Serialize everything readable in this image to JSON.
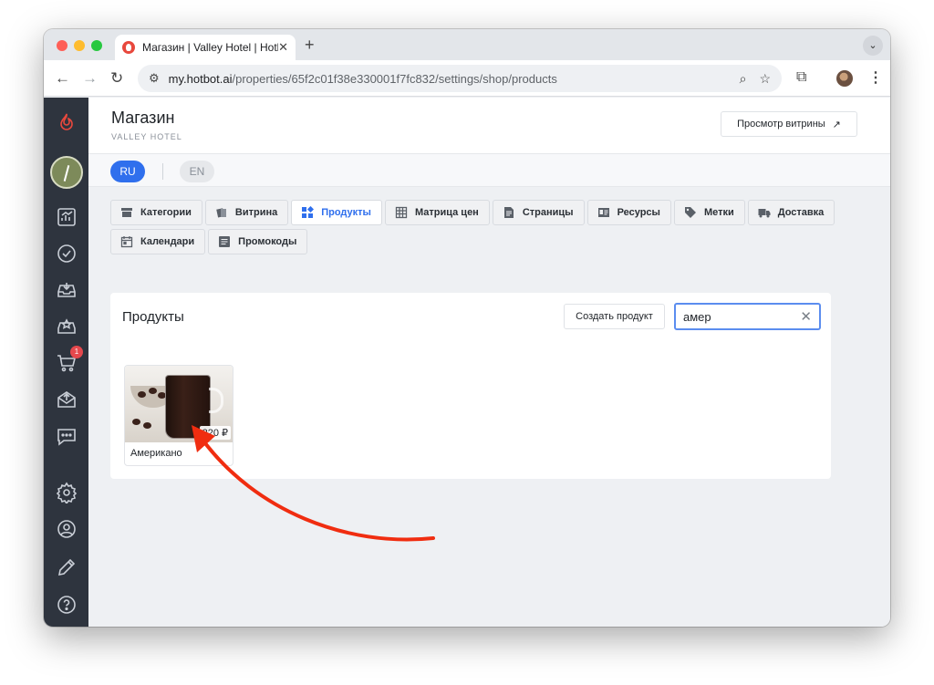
{
  "browser": {
    "tab_title": "Магазин | Valley Hotel | Hotbot",
    "tab_close": "✕",
    "new_tab": "+",
    "url_host": "my.hotbot.ai",
    "url_path": "/properties/65f2c01f38e330001f7fc832/settings/shop/products"
  },
  "header": {
    "title": "Магазин",
    "subtitle": "VALLEY HOTEL",
    "view_storefront_label": "Просмотр витрины",
    "view_storefront_icon": "↗"
  },
  "languages": {
    "active": "RU",
    "other": "EN"
  },
  "tabs": {
    "row1": [
      {
        "label": "Категории",
        "icon": "store-icon"
      },
      {
        "label": "Витрина",
        "icon": "cards-icon"
      },
      {
        "label": "Продукты",
        "icon": "grid-icon",
        "active": true
      },
      {
        "label": "Матрица цен",
        "icon": "table-icon"
      },
      {
        "label": "Страницы",
        "icon": "page-icon"
      },
      {
        "label": "Ресурсы",
        "icon": "id-card-icon"
      },
      {
        "label": "Метки",
        "icon": "tag-icon"
      },
      {
        "label": "Доставка",
        "icon": "truck-icon"
      }
    ],
    "row2": [
      {
        "label": "Календари",
        "icon": "calendar-icon"
      },
      {
        "label": "Промокоды",
        "icon": "list-icon"
      }
    ]
  },
  "products": {
    "title": "Продукты",
    "create_label": "Создать продукт",
    "search_value": "амер",
    "clear_icon": "✕",
    "items": [
      {
        "name": "Американо",
        "price": "220 ₽"
      }
    ]
  },
  "sidebar": {
    "cart_badge": "1"
  },
  "colors": {
    "accent": "#2f6fed",
    "sidebar": "#2e343e",
    "annotation_arrow": "#f02d10"
  }
}
